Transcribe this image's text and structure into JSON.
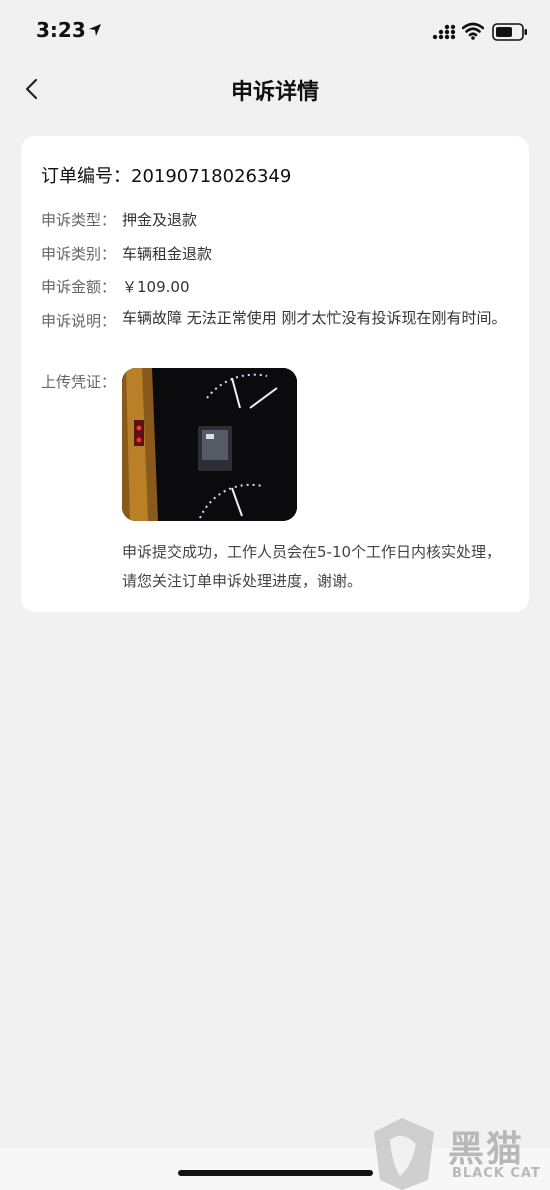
{
  "status_bar": {
    "time": "3:23"
  },
  "nav": {
    "title": "申诉详情"
  },
  "order": {
    "label": "订单编号：",
    "number": "20190718026349"
  },
  "fields": [
    {
      "label": "申诉类型：",
      "value": "押金及退款"
    },
    {
      "label": "申诉类别：",
      "value": "车辆租金退款"
    },
    {
      "label": "申诉金额：",
      "value": "￥109.00"
    },
    {
      "label": "申诉说明：",
      "value": "车辆故障 无法正常使用 刚才太忙没有投诉现在刚有时间。"
    }
  ],
  "evidence": {
    "label": "上传凭证："
  },
  "notice": "申诉提交成功，工作人员会在5-10个工作日内核实处理，请您关注订单申诉处理进度，谢谢。",
  "watermark": {
    "main": "黑猫",
    "sub": "BLACK CAT"
  },
  "colors": {
    "background": "#f1f1f1",
    "card": "#ffffff",
    "label": "#666666",
    "value": "#333333"
  }
}
